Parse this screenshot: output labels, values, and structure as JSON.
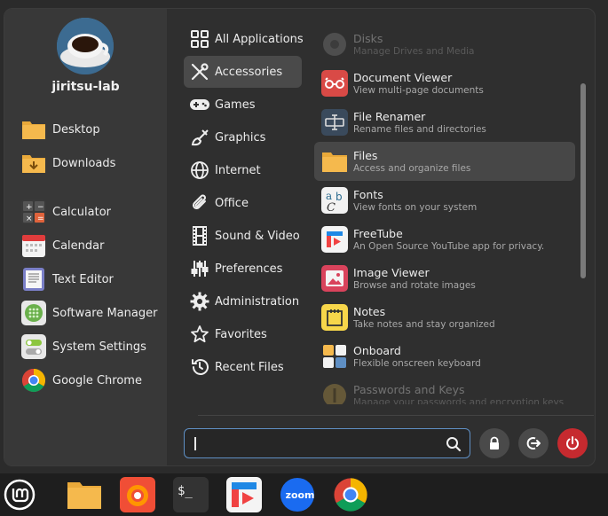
{
  "user": {
    "name": "jiritsu-lab"
  },
  "favorites": [
    {
      "label": "Desktop",
      "icon": "folder-icon"
    },
    {
      "label": "Downloads",
      "icon": "downloads-folder-icon"
    },
    {
      "label": "Calculator",
      "icon": "calculator-icon"
    },
    {
      "label": "Calendar",
      "icon": "calendar-icon"
    },
    {
      "label": "Text Editor",
      "icon": "text-editor-icon"
    },
    {
      "label": "Software Manager",
      "icon": "software-manager-icon"
    },
    {
      "label": "System Settings",
      "icon": "settings-icon"
    },
    {
      "label": "Google Chrome",
      "icon": "chrome-icon"
    }
  ],
  "categories": [
    {
      "label": "All Applications",
      "icon": "grid-icon"
    },
    {
      "label": "Accessories",
      "icon": "tools-icon",
      "active": true
    },
    {
      "label": "Games",
      "icon": "gamepad-icon"
    },
    {
      "label": "Graphics",
      "icon": "paint-icon"
    },
    {
      "label": "Internet",
      "icon": "globe-icon"
    },
    {
      "label": "Office",
      "icon": "paperclip-icon"
    },
    {
      "label": "Sound & Video",
      "icon": "film-icon"
    },
    {
      "label": "Preferences",
      "icon": "sliders-icon"
    },
    {
      "label": "Administration",
      "icon": "gear-icon"
    },
    {
      "label": "Favorites",
      "icon": "star-icon"
    },
    {
      "label": "Recent Files",
      "icon": "history-icon"
    }
  ],
  "apps": [
    {
      "name": "Disks",
      "desc": "Manage Drives and Media",
      "icon": "disks-icon"
    },
    {
      "name": "Document Viewer",
      "desc": "View multi-page documents",
      "icon": "document-viewer-icon"
    },
    {
      "name": "File Renamer",
      "desc": "Rename files and directories",
      "icon": "file-renamer-icon"
    },
    {
      "name": "Files",
      "desc": "Access and organize files",
      "icon": "folder-icon"
    },
    {
      "name": "Fonts",
      "desc": "View fonts on your system",
      "icon": "fonts-icon"
    },
    {
      "name": "FreeTube",
      "desc": "An Open Source YouTube app for privacy.",
      "icon": "freetube-icon"
    },
    {
      "name": "Image Viewer",
      "desc": "Browse and rotate images",
      "icon": "image-viewer-icon"
    },
    {
      "name": "Notes",
      "desc": "Take notes and stay organized",
      "icon": "notes-icon"
    },
    {
      "name": "Onboard",
      "desc": "Flexible onscreen keyboard",
      "icon": "keyboard-icon"
    },
    {
      "name": "Passwords and Keys",
      "desc": "Manage your passwords and encryption keys",
      "icon": "keys-icon"
    }
  ],
  "search": {
    "value": ""
  },
  "fonts_icon_text": {
    "a": "a",
    "b": "b",
    "c": "C"
  },
  "taskbar": {
    "zoom_label": "zoom",
    "terminal_label": "$_",
    "items": [
      "mint-menu-icon",
      "files-icon",
      "firefox-icon",
      "terminal-icon",
      "freetube-icon",
      "zoom-icon",
      "chrome-icon"
    ]
  },
  "colors": {
    "accent": "#5f8fc4",
    "power": "#c62a2f",
    "folder": "#f5b94d"
  }
}
